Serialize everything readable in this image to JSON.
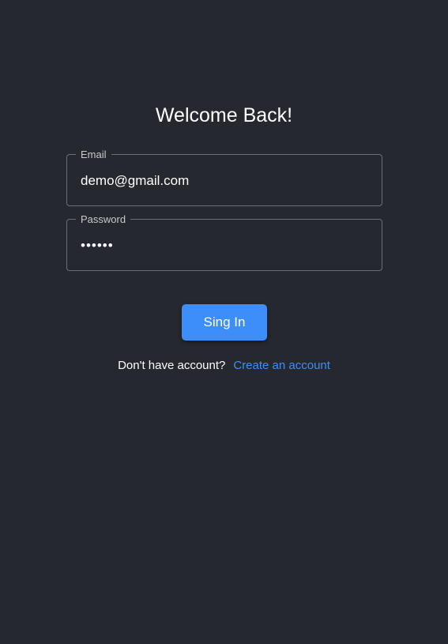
{
  "page": {
    "title": "Welcome Back!"
  },
  "form": {
    "email": {
      "label": "Email",
      "value": "demo@gmail.com"
    },
    "password": {
      "label": "Password",
      "value": "••••••"
    },
    "submit_label": "Sing In"
  },
  "footer": {
    "prompt": "Don't have account?",
    "link_label": "Create an account"
  },
  "colors": {
    "background": "#262830",
    "accent": "#3d8ef8",
    "border": "#6c6e75"
  }
}
